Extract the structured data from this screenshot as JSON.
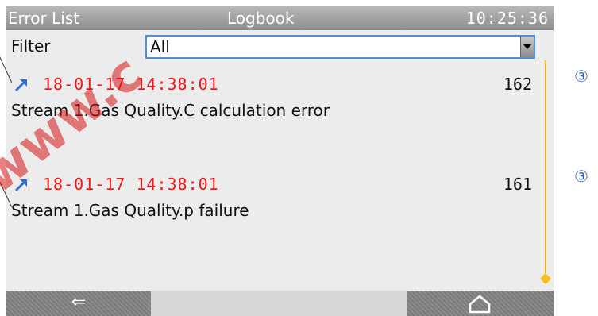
{
  "titlebar": {
    "left": "Error List",
    "center": "Logbook",
    "time": "10:25:36"
  },
  "filter": {
    "label": "Filter",
    "value": "All"
  },
  "entries": [
    {
      "timestamp": "18-01-17 14:38:01",
      "number": "162",
      "message": "Stream 1.Gas Quality.C calculation error"
    },
    {
      "timestamp": "18-01-17 14:38:01",
      "number": "161",
      "message": "Stream 1.Gas Quality.p failure"
    }
  ],
  "bottombar": {
    "back_symbol": "⇐",
    "home_symbol": "⌂"
  },
  "callouts": [
    "③",
    "③"
  ],
  "watermark": "www.c",
  "colors": {
    "timestamp": "#f01818",
    "accent": "#4b8fd6",
    "scrollbar": "#e8b820"
  },
  "icons": [
    "arrow-up-right-icon",
    "back-arrow-icon",
    "home-icon",
    "dropdown-icon"
  ]
}
